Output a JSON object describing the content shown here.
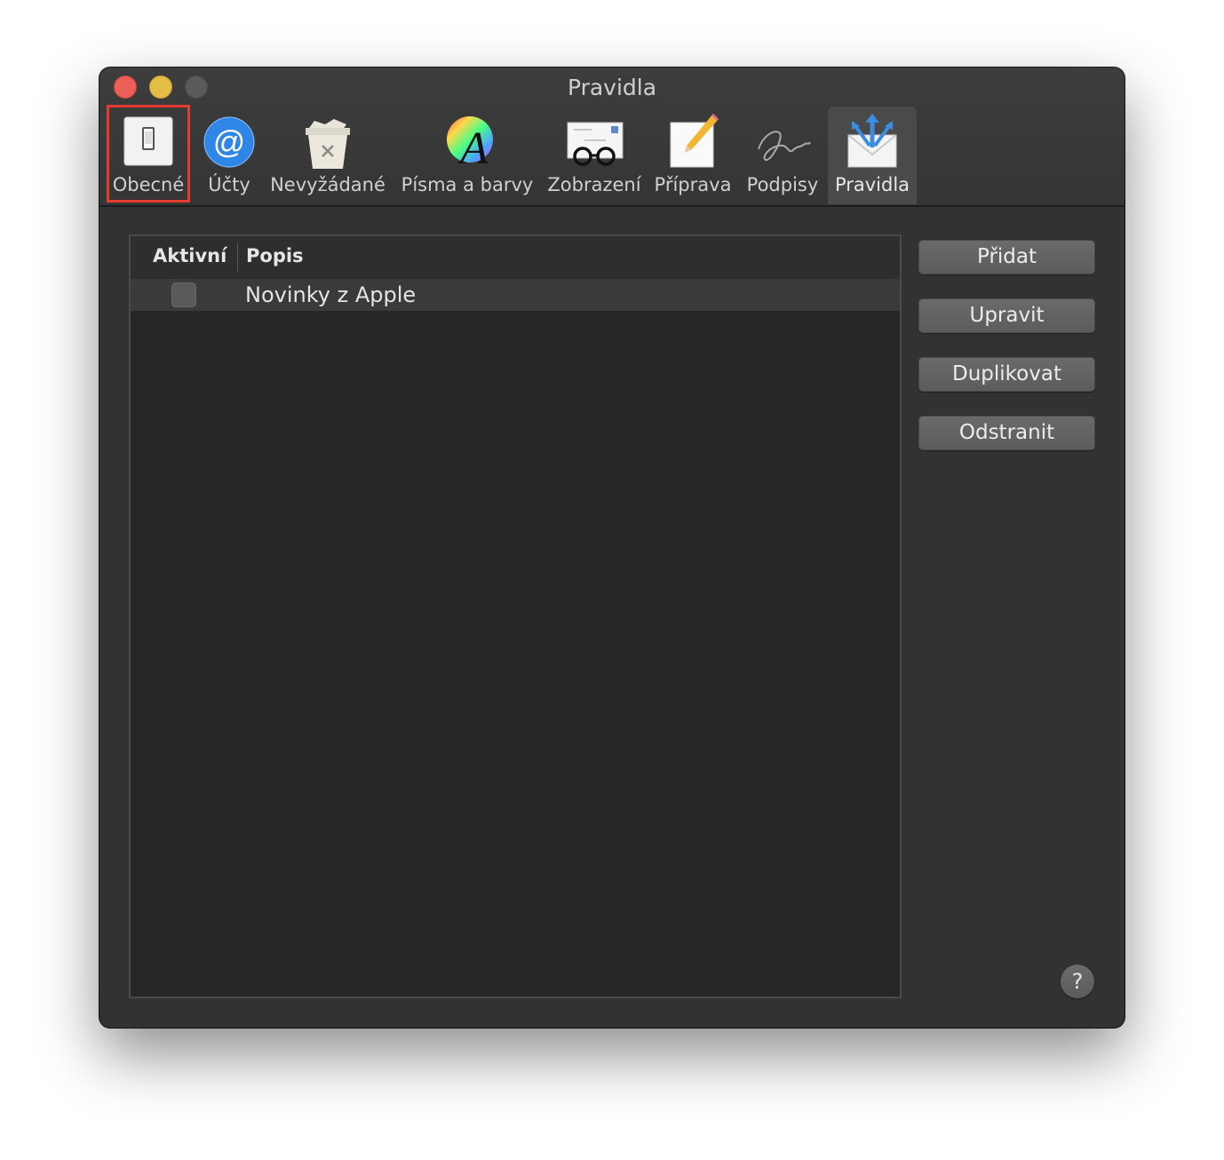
{
  "window": {
    "title": "Pravidla"
  },
  "tabs": [
    {
      "label": "Obecné",
      "icon": "switch-icon"
    },
    {
      "label": "Účty",
      "icon": "at-sign-icon"
    },
    {
      "label": "Nevyžádané",
      "icon": "junk-trash-icon"
    },
    {
      "label": "Písma a barvy",
      "icon": "fonts-colors-icon"
    },
    {
      "label": "Zobrazení",
      "icon": "glasses-letter-icon"
    },
    {
      "label": "Příprava",
      "icon": "pencil-paper-icon"
    },
    {
      "label": "Podpisy",
      "icon": "signature-icon"
    },
    {
      "label": "Pravidla",
      "icon": "rules-envelope-icon",
      "selected": true
    }
  ],
  "table": {
    "columns": [
      "Aktivní",
      "Popis"
    ],
    "rows": [
      {
        "active": false,
        "description": "Novinky z Apple"
      }
    ]
  },
  "buttons": {
    "add": "Přidat",
    "edit": "Upravit",
    "duplicate": "Duplikovat",
    "remove": "Odstranit"
  },
  "help": "?",
  "colors": {
    "highlight": "#e23d2e",
    "accent": "#3a8de0"
  }
}
